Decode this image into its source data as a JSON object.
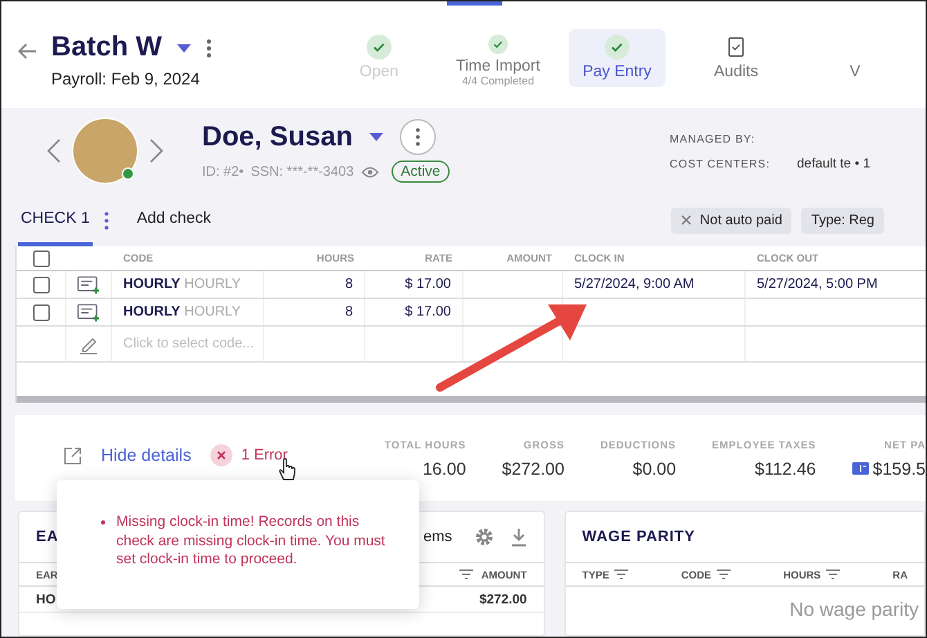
{
  "header": {
    "title": "Batch W",
    "subtitle": "Payroll: Feb 9, 2024"
  },
  "steps": [
    {
      "label": "Open",
      "kind": "check",
      "selected": false,
      "disabled": true
    },
    {
      "label": "Time Import",
      "sublabel": "4/4 Completed",
      "kind": "check",
      "selected": false,
      "disabled": false
    },
    {
      "label": "Pay Entry",
      "kind": "check",
      "selected": true,
      "disabled": false
    },
    {
      "label": "Audits",
      "kind": "clipboard",
      "selected": false,
      "disabled": false
    },
    {
      "label": "V",
      "selected": false,
      "disabled": false
    }
  ],
  "employee": {
    "name": "Doe, Susan",
    "id": "ID: #2•",
    "ssn": "SSN: ***-**-3403",
    "status": "Active",
    "online": true,
    "managed_by_label": "MANAGED BY:",
    "cost_centers_label": "COST CENTERS:",
    "cost_centers": "default te • 1"
  },
  "check_tabs": [
    {
      "label": "CHECK 1",
      "selected": true
    },
    {
      "label": "Add check",
      "selected": false
    }
  ],
  "chips": [
    {
      "label": "Not auto paid",
      "kind": "removable"
    },
    {
      "label": "Type: Reg",
      "kind": "plain"
    }
  ],
  "table": {
    "all_selected": false,
    "columns": [
      "CODE",
      "HOURS",
      "RATE",
      "AMOUNT",
      "CLOCK IN",
      "CLOCK OUT"
    ],
    "rows": [
      {
        "kind": "entry",
        "checked": false,
        "code": "HOURLY",
        "code_desc": "HOURLY",
        "hours": "8",
        "rate": "$ 17.00",
        "clock_in": "5/27/2024, 9:00 AM",
        "clock_out": "5/27/2024, 5:00 PM"
      },
      {
        "kind": "entry",
        "checked": false,
        "code": "HOURLY",
        "code_desc": "HOURLY",
        "hours": "8",
        "rate": "$ 17.00"
      },
      {
        "kind": "new",
        "placeholder": "Click to select code..."
      }
    ]
  },
  "summary": {
    "toggle": "Hide details",
    "error": "1 Error",
    "stats": [
      {
        "label": "TOTAL HOURS",
        "value": "16.00",
        "kind": "plain"
      },
      {
        "label": "GROSS",
        "value": "$272.00",
        "kind": "plain"
      },
      {
        "label": "DEDUCTIONS",
        "value": "$0.00",
        "kind": "plain"
      },
      {
        "label": "EMPLOYEE TAXES",
        "value": "$112.46",
        "kind": "plain"
      },
      {
        "label": "NET PA",
        "value": "$159.5",
        "kind": "payment"
      }
    ]
  },
  "error_popup": {
    "messages": [
      "Missing clock-in time! Records on this check are missing clock-in time. You must set clock-in time to proceed."
    ]
  },
  "earnings": {
    "title": "EA",
    "toolbar_text": "ems",
    "columns": [
      {
        "label": "EAR",
        "filterable": false
      },
      {
        "label": "AMOUNT",
        "filterable": true
      }
    ],
    "rows": [
      {
        "code": "HO",
        "amount": "$272.00"
      }
    ]
  },
  "wage_parity": {
    "title": "WAGE PARITY",
    "columns": [
      {
        "label": "TYPE",
        "filterable": true
      },
      {
        "label": "CODE",
        "filterable": true
      },
      {
        "label": "HOURS",
        "filterable": true
      },
      {
        "label": "RA",
        "filterable": false
      }
    ],
    "empty": "No wage parity"
  }
}
